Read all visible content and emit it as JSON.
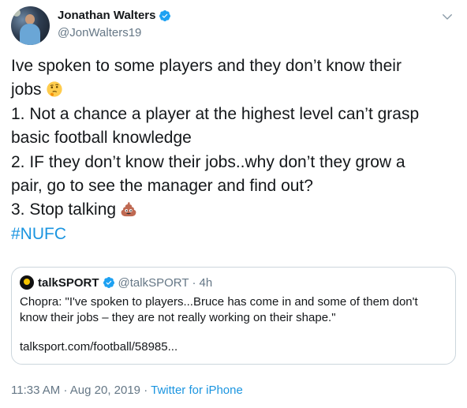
{
  "author": {
    "name": "Jonathan Walters",
    "handle": "@JonWalters19",
    "verified": true
  },
  "tweet": {
    "lines": [
      "Ive spoken to some players and they don’t know their",
      "jobs",
      "1. Not a chance a player at the highest level can’t grasp",
      "basic football knowledge",
      "2. IF they don’t know their jobs..why don’t they grow a",
      "pair, go to see the manager and find out?",
      "3. Stop talking"
    ],
    "hashtag": "#NUFC",
    "emojis": [
      "thinking-face-icon",
      "pile-of-poo-icon"
    ]
  },
  "quote": {
    "name": "talkSPORT",
    "handle": "@talkSPORT",
    "separator": "·",
    "time": "4h",
    "body_lines": [
      "Chopra: \"I've spoken to players...Bruce has come in and some of them don't",
      "know their jobs – they are not really working on their shape.\""
    ],
    "link": "talksport.com/football/58985..."
  },
  "meta": {
    "time": "11:33 AM",
    "separator": "·",
    "date": "Aug 20, 2019",
    "source": "Twitter for iPhone"
  },
  "colors": {
    "text": "#14171a",
    "secondary": "#657786",
    "accent": "#1b95e0",
    "verified": "#1da1f2",
    "border": "#ccd6dd"
  }
}
